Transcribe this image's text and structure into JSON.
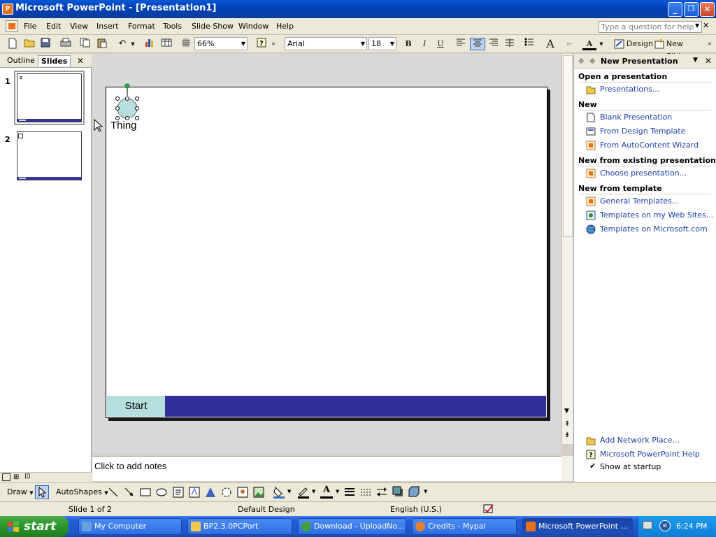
{
  "window": {
    "title": "Microsoft PowerPoint - [Presentation1]",
    "app_icon_letter": "P",
    "minimize": "_",
    "restore": "❐",
    "close": "✕"
  },
  "menu": {
    "items": [
      "File",
      "Edit",
      "View",
      "Insert",
      "Format",
      "Tools",
      "Slide Show",
      "Window",
      "Help"
    ],
    "help_placeholder": "Type a question for help",
    "close_doc": "✕"
  },
  "toolbar": {
    "zoom": "66%",
    "font": "Arial",
    "font_size": "18",
    "bold": "B",
    "italic": "I",
    "underline": "U",
    "font_color": "A",
    "design_label": "Design",
    "new_slide_label": "New Slide"
  },
  "left_panel": {
    "tabs": [
      "Outline",
      "Slides"
    ],
    "close": "✕",
    "slides": [
      {
        "number": "1"
      },
      {
        "number": "2"
      }
    ]
  },
  "slide": {
    "shape_label": "Thing",
    "footer_label": "Start",
    "colors": {
      "footer_band": "#30309a",
      "start_box": "#b7dede",
      "shape_fill": "#b7dede"
    }
  },
  "notes": {
    "placeholder": "Click to add notes"
  },
  "task_pane": {
    "title": "New Presentation",
    "sections": {
      "open": {
        "heading": "Open a presentation",
        "links": [
          "Presentations..."
        ]
      },
      "new": {
        "heading": "New",
        "links": [
          "Blank Presentation",
          "From Design Template",
          "From AutoContent Wizard"
        ]
      },
      "existing": {
        "heading": "New from existing presentation",
        "links": [
          "Choose presentation..."
        ]
      },
      "template": {
        "heading": "New from template",
        "links": [
          "General Templates...",
          "Templates on my Web Sites...",
          "Templates on Microsoft.com"
        ]
      }
    },
    "bottom_links": [
      "Add Network Place...",
      "Microsoft PowerPoint Help"
    ],
    "show_at_startup": "Show at startup"
  },
  "drawing_toolbar": {
    "draw_label": "Draw",
    "autoshapes_label": "AutoShapes"
  },
  "status_bar": {
    "slide_position": "Slide 1 of 2",
    "design": "Default Design",
    "language": "English (U.S.)"
  },
  "taskbar": {
    "start_label": "start",
    "tasks": [
      "My Computer",
      "BP2.3.0PCPort",
      "Download - UploadNo...",
      "Credits - Mypal",
      "Microsoft PowerPoint ..."
    ],
    "clock": "6:24 PM"
  }
}
